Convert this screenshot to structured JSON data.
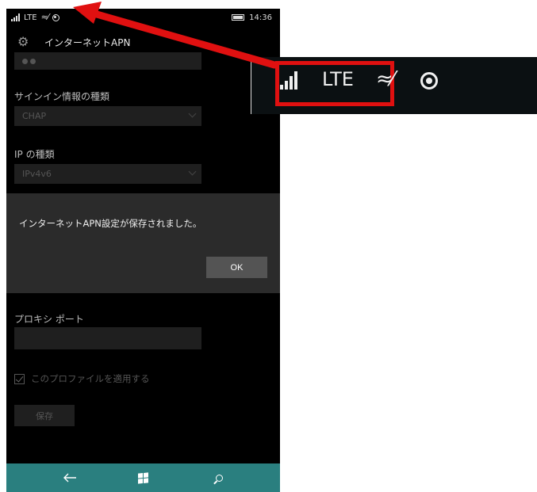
{
  "statusbar": {
    "network": "LTE",
    "time": "14:36"
  },
  "header": {
    "title": "インターネットAPN"
  },
  "form": {
    "signin_type_label": "サインイン情報の種類",
    "signin_type_value": "CHAP",
    "ip_type_label": "IP の種類",
    "ip_type_value": "IPv4v6",
    "proxy_port_label": "プロキシ ポート",
    "apply_profile_label": "このプロファイルを適用する",
    "save_label": "保存"
  },
  "dialog": {
    "message": "インターネットAPN設定が保存されました。",
    "ok_label": "OK"
  },
  "navbar": {
    "back_icon": "back-arrow",
    "start_icon": "windows-logo",
    "search_icon": "search"
  },
  "callout": {
    "network": "LTE",
    "highlight_color": "#e01010",
    "arrow_color": "#e01010"
  },
  "colors": {
    "navbar": "#2a7f7f",
    "dialog": "#2b2b2b",
    "background": "#000000"
  }
}
